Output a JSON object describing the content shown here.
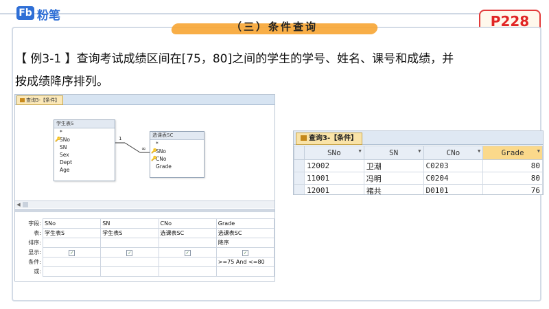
{
  "header": {
    "logo_mark": "Fb",
    "logo_text": "粉笔",
    "section_title": "（三）条件查询",
    "page_badge": "P228"
  },
  "question": {
    "line1": "【 例3-1 】查询考试成绩区间在[75，80]之间的学生的学号、姓名、课号和成绩，并",
    "line2": "按成绩降序排列。"
  },
  "design_view": {
    "tab_label": "查询3-【条件】",
    "table_s": {
      "title": "学生表S",
      "fields": [
        {
          "name": "*",
          "key": false
        },
        {
          "name": "SNo",
          "key": true
        },
        {
          "name": "SN",
          "key": false
        },
        {
          "name": "Sex",
          "key": false
        },
        {
          "name": "Dept",
          "key": false
        },
        {
          "name": "Age",
          "key": false
        }
      ]
    },
    "table_sc": {
      "title": "选课表SC",
      "fields": [
        {
          "name": "*",
          "key": false
        },
        {
          "name": "SNo",
          "key": true
        },
        {
          "name": "CNo",
          "key": true
        },
        {
          "name": "Grade",
          "key": false
        }
      ]
    },
    "relation_one": "1",
    "relation_many": "∞",
    "grid": {
      "row_labels": [
        "字段:",
        "表:",
        "排序:",
        "显示:",
        "条件:",
        "或:"
      ],
      "columns": [
        {
          "field": "SNo",
          "table": "学生表S",
          "sort": "",
          "show": true,
          "criteria": ""
        },
        {
          "field": "SN",
          "table": "学生表S",
          "sort": "",
          "show": true,
          "criteria": ""
        },
        {
          "field": "CNo",
          "table": "选课表SC",
          "sort": "",
          "show": true,
          "criteria": ""
        },
        {
          "field": "Grade",
          "table": "选课表SC",
          "sort": "降序",
          "show": true,
          "criteria": ">=75 And <=80"
        }
      ]
    }
  },
  "result_view": {
    "tab_label": "查询3-【条件】",
    "columns": [
      "SNo",
      "SN",
      "CNo",
      "Grade"
    ],
    "rows": [
      [
        "12002",
        "卫潮",
        "C0203",
        "80"
      ],
      [
        "11001",
        "冯明",
        "C0204",
        "80"
      ],
      [
        "12001",
        "褚共",
        "D0101",
        "76"
      ]
    ]
  },
  "colors": {
    "brand_blue": "#2f6fd6",
    "badge_red": "#e12525",
    "highlight": "#f7a533"
  }
}
